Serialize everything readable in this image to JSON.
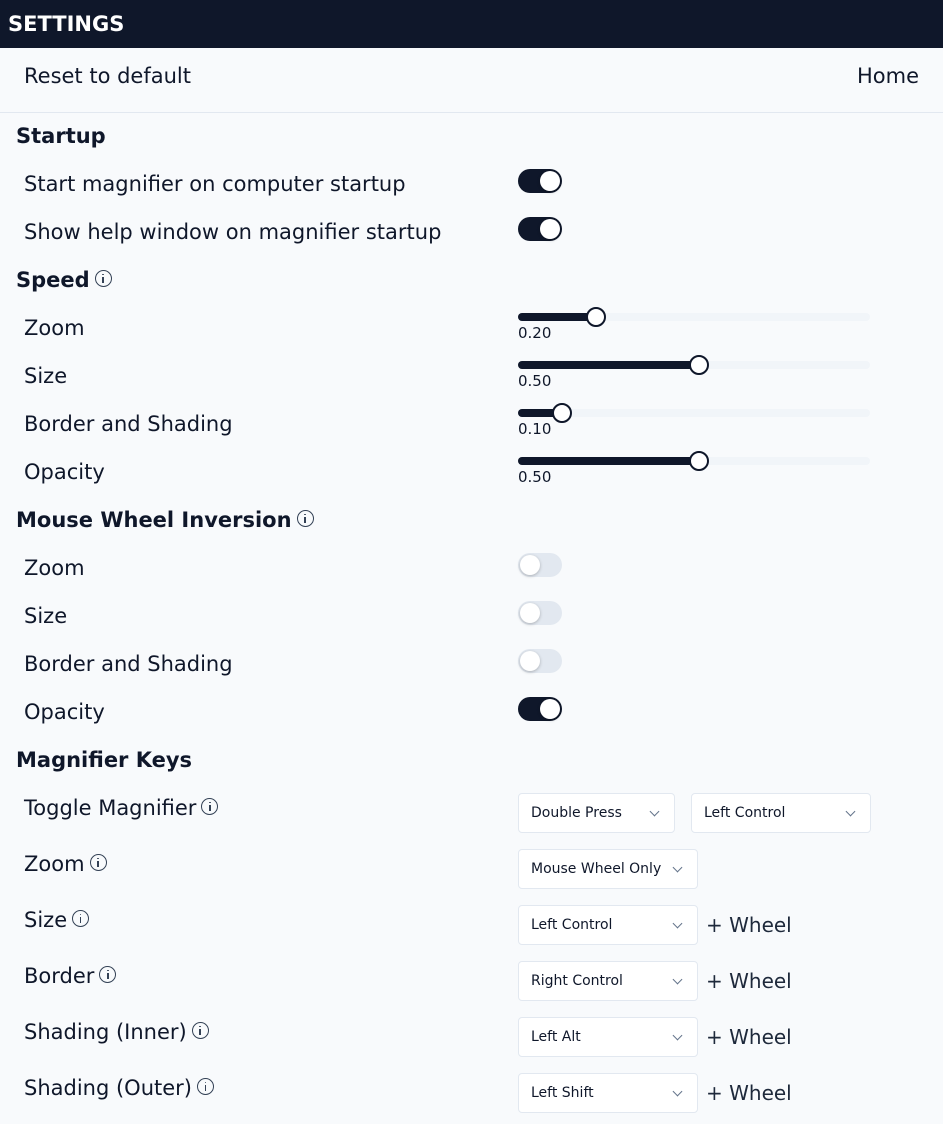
{
  "window": {
    "title": "SETTINGS"
  },
  "toolbar": {
    "reset_label": "Reset to default",
    "home_label": "Home"
  },
  "startup": {
    "title": "Startup",
    "items": [
      {
        "label": "Start magnifier on computer startup",
        "on": true
      },
      {
        "label": "Show help window on magnifier startup",
        "on": true
      }
    ]
  },
  "speed": {
    "title": "Speed",
    "info_icon": "info-icon",
    "items": [
      {
        "label": "Zoom",
        "value": 0.2,
        "display": "0.20"
      },
      {
        "label": "Size",
        "value": 0.5,
        "display": "0.50"
      },
      {
        "label": "Border and Shading",
        "value": 0.1,
        "display": "0.10"
      },
      {
        "label": "Opacity",
        "value": 0.5,
        "display": "0.50"
      }
    ]
  },
  "inversion": {
    "title": "Mouse Wheel Inversion",
    "info_icon": "info-icon",
    "items": [
      {
        "label": "Zoom",
        "on": false
      },
      {
        "label": "Size",
        "on": false
      },
      {
        "label": "Border and Shading",
        "on": false
      },
      {
        "label": "Opacity",
        "on": true
      }
    ]
  },
  "keys": {
    "title": "Magnifier Keys",
    "wheel_suffix": "+ Wheel",
    "items": [
      {
        "label": "Toggle Magnifier",
        "select1": "Double Press",
        "select2": "Left Control"
      },
      {
        "label": "Zoom",
        "select1": "Mouse Wheel Only"
      },
      {
        "label": "Size",
        "select1": "Left Control"
      },
      {
        "label": "Border",
        "select1": "Right Control"
      },
      {
        "label": "Shading (Inner)",
        "select1": "Left Alt"
      },
      {
        "label": "Shading (Outer)",
        "select1": "Left Shift"
      }
    ]
  },
  "colors": {
    "accent": "#0f172a",
    "background": "#f8fafc",
    "toggle_off": "#e2e8f0",
    "track": "#f1f5f9"
  }
}
